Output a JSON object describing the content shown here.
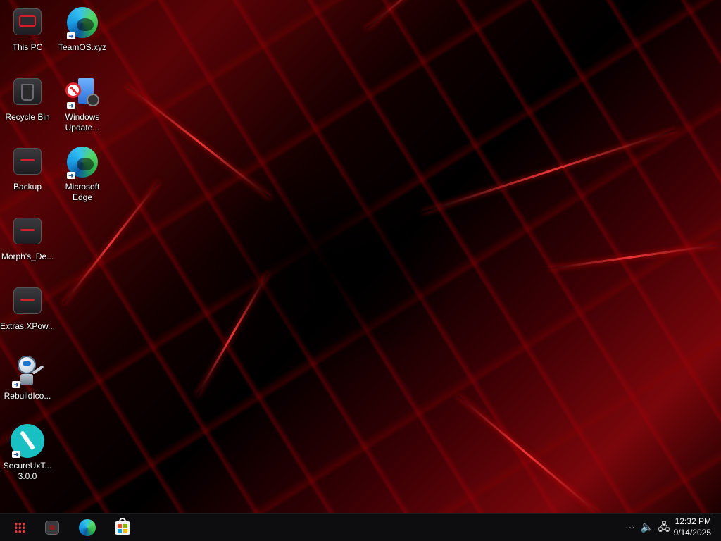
{
  "desktop": {
    "icons": [
      {
        "label": "This PC",
        "icon": "computer-icon"
      },
      {
        "label": "TeamOS.xyz",
        "icon": "edge-shortcut-icon"
      },
      {
        "label": "Recycle Bin",
        "icon": "recycle-bin-icon"
      },
      {
        "label": "Windows\nUpdate...",
        "icon": "windows-update-blocker-icon"
      },
      {
        "label": "Backup",
        "icon": "folder-icon"
      },
      {
        "label": "Microsoft\nEdge",
        "icon": "edge-icon"
      },
      {
        "label": "Morph's_De...",
        "icon": "folder-icon"
      },
      {
        "label": "Extras.XPow...",
        "icon": "folder-icon"
      },
      {
        "label": "RebuildIco...",
        "icon": "robot-icon"
      },
      {
        "label": "SecureUxT...\n3.0.0",
        "icon": "brush-icon"
      }
    ]
  },
  "taskbar": {
    "apps": [
      {
        "name": "start",
        "icon": "start-grid-icon"
      },
      {
        "name": "camera",
        "icon": "camera-icon"
      },
      {
        "name": "edge",
        "icon": "edge-icon"
      },
      {
        "name": "store",
        "icon": "store-icon"
      }
    ],
    "tray": {
      "overflow": "···",
      "volume_icon": "🔈",
      "network_icon": "🖧"
    },
    "clock": {
      "time": "12:32 PM",
      "date": "9/14/2025"
    }
  },
  "colors": {
    "accent": "#d4202a",
    "taskbar_bg": "#0d0d0f",
    "text": "#ffffff"
  }
}
